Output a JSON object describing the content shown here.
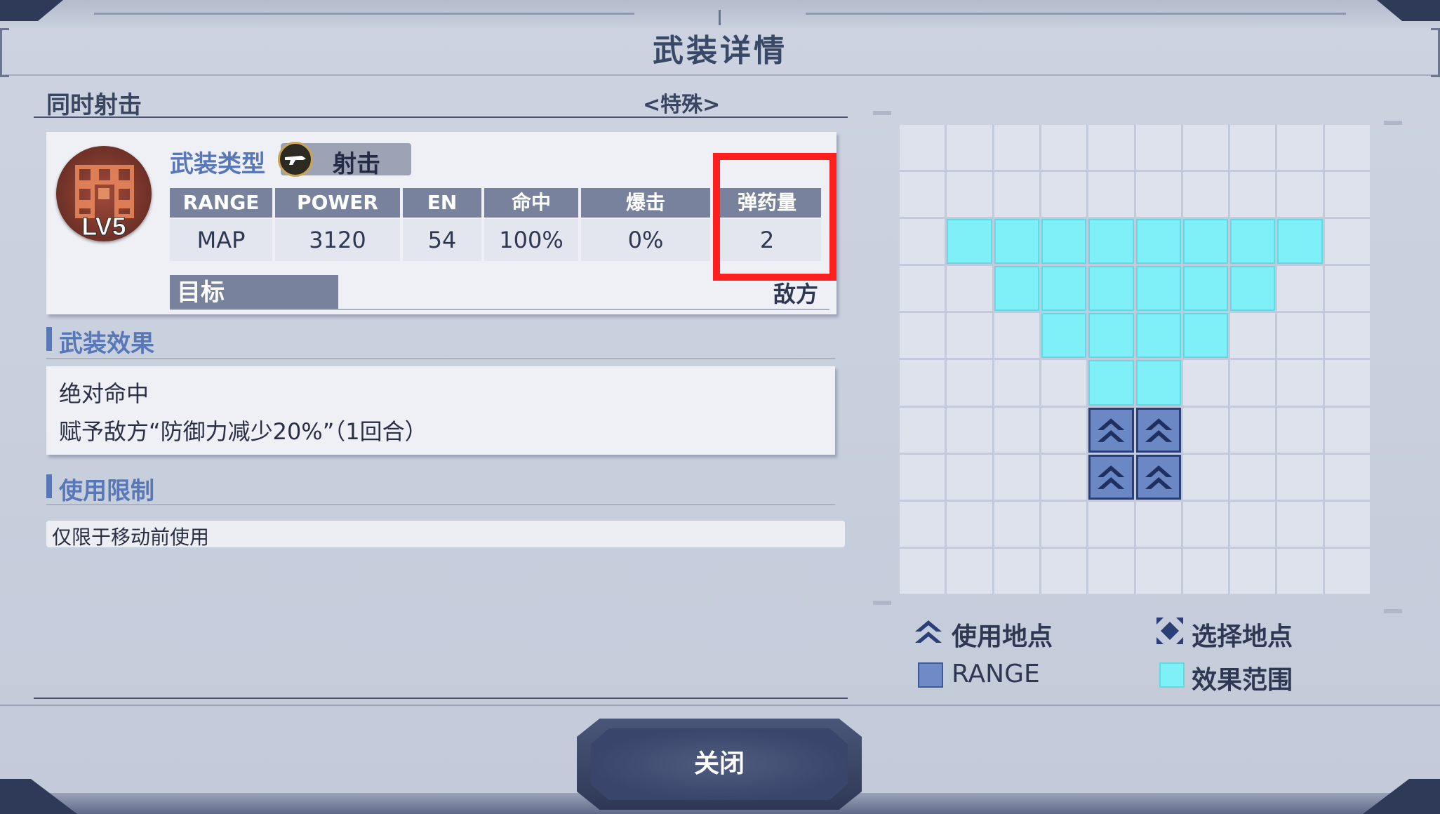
{
  "window": {
    "title": "武装详情"
  },
  "weapon": {
    "name": "同时射击",
    "category": "<特殊>",
    "level": "LV5",
    "type_label": "武装类型",
    "type_value": "射击",
    "type_icon": "gun-icon"
  },
  "stats": {
    "headers": [
      "RANGE",
      "POWER",
      "EN",
      "命中",
      "爆击",
      "弹药量"
    ],
    "values": [
      "MAP",
      "3120",
      "54",
      "100%",
      "0%",
      "2"
    ]
  },
  "target": {
    "label": "目标",
    "value": "敌方"
  },
  "effects": {
    "title": "武装效果",
    "lines": [
      "绝对命中",
      "赋予敌方“防御力减少20%”（1回合）"
    ]
  },
  "restriction": {
    "title": "使用限制",
    "text": "仅限于移动前使用"
  },
  "range_grid": {
    "rows": 10,
    "cols": 10,
    "effect_cells": [
      [
        2,
        1
      ],
      [
        2,
        2
      ],
      [
        2,
        3
      ],
      [
        2,
        4
      ],
      [
        2,
        5
      ],
      [
        2,
        6
      ],
      [
        2,
        7
      ],
      [
        2,
        8
      ],
      [
        3,
        2
      ],
      [
        3,
        3
      ],
      [
        3,
        4
      ],
      [
        3,
        5
      ],
      [
        3,
        6
      ],
      [
        3,
        7
      ],
      [
        4,
        3
      ],
      [
        4,
        4
      ],
      [
        4,
        5
      ],
      [
        4,
        6
      ],
      [
        5,
        4
      ],
      [
        5,
        5
      ]
    ],
    "use_cells": [
      [
        6,
        4
      ],
      [
        6,
        5
      ],
      [
        7,
        4
      ],
      [
        7,
        5
      ]
    ]
  },
  "legend": {
    "use_point": "使用地点",
    "select_point": "选择地点",
    "range": "RANGE",
    "effect_range": "效果范围",
    "colors": {
      "range": "#6f8ac6",
      "effect": "#7ff0f7"
    }
  },
  "close_button": {
    "label": "关闭"
  },
  "highlight_color": "#ff1f1f"
}
